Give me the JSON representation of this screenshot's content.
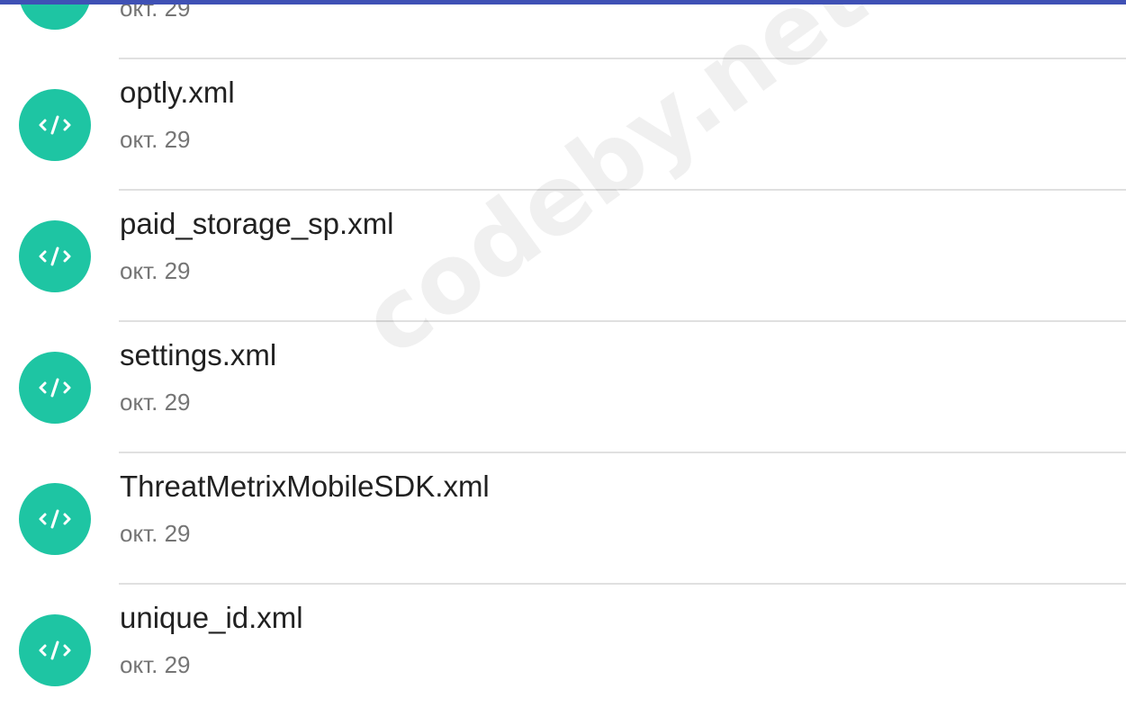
{
  "app_bar": {
    "color": "#3f51b5"
  },
  "files": [
    {
      "name": "",
      "date": "окт. 29",
      "icon": "code-file-icon"
    },
    {
      "name": "optly.xml",
      "date": "окт. 29",
      "icon": "code-file-icon"
    },
    {
      "name": "paid_storage_sp.xml",
      "date": "окт. 29",
      "icon": "code-file-icon"
    },
    {
      "name": "settings.xml",
      "date": "окт. 29",
      "icon": "code-file-icon"
    },
    {
      "name": "ThreatMetrixMobileSDK.xml",
      "date": "окт. 29",
      "icon": "code-file-icon"
    },
    {
      "name": "unique_id.xml",
      "date": "окт. 29",
      "icon": "code-file-icon"
    }
  ],
  "colors": {
    "icon_background": "#1ec5a3",
    "divider": "#e0e0e0",
    "primary_text": "#212121",
    "secondary_text": "#757575"
  },
  "watermark": "codeby.net"
}
